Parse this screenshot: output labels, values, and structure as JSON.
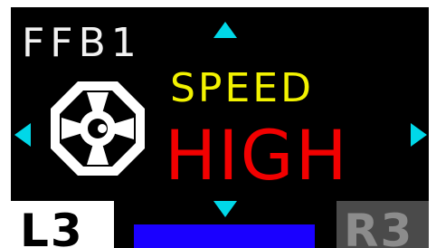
{
  "screen": {
    "channel": "FFB1",
    "setting": "SPEED",
    "value": "HIGH"
  },
  "buttons": {
    "left": "L3",
    "right": "R3"
  },
  "colors": {
    "background": "#000000",
    "channel_text": "#f2f2f2",
    "setting_text": "#f2f200",
    "value_text": "#f20000",
    "arrows": "#00d8e8",
    "status_bar": "#1a00ff",
    "l3_bg": "#ffffff",
    "r3_bg": "#4a4a4a"
  },
  "icons": {
    "arrow_up": "triangle-up-icon",
    "arrow_down": "triangle-down-icon",
    "arrow_left": "triangle-left-icon",
    "arrow_right": "triangle-right-icon",
    "wheel": "steering-wheel-icon"
  }
}
